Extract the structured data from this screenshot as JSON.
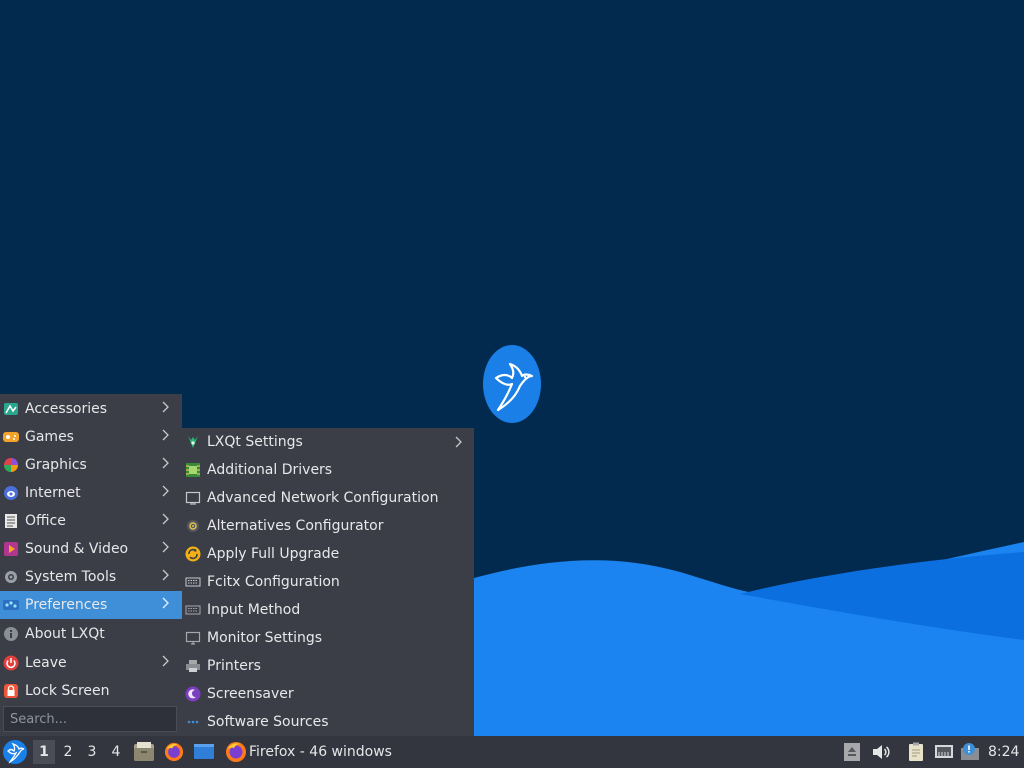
{
  "desktop": {
    "colors": {
      "background": "#022a4e",
      "wave_light": "#1b84f0",
      "wave_dark": "#0a66d9"
    },
    "logo_icon": "lubuntu-hummingbird-logo"
  },
  "main_menu": {
    "items": [
      {
        "label": "Accessories",
        "icon": "accessories-icon",
        "submenu": true
      },
      {
        "label": "Games",
        "icon": "games-icon",
        "submenu": true
      },
      {
        "label": "Graphics",
        "icon": "graphics-icon",
        "submenu": true
      },
      {
        "label": "Internet",
        "icon": "internet-icon",
        "submenu": true
      },
      {
        "label": "Office",
        "icon": "office-icon",
        "submenu": true
      },
      {
        "label": "Sound & Video",
        "icon": "sound-video-icon",
        "submenu": true
      },
      {
        "label": "System Tools",
        "icon": "system-tools-icon",
        "submenu": true
      },
      {
        "label": "Preferences",
        "icon": "preferences-icon",
        "submenu": true,
        "active": true
      },
      {
        "label": "About LXQt",
        "icon": "info-icon",
        "submenu": false
      },
      {
        "label": "Leave",
        "icon": "power-icon",
        "submenu": true
      },
      {
        "label": "Lock Screen",
        "icon": "lock-icon",
        "submenu": false
      }
    ],
    "search_placeholder": "Search..."
  },
  "preferences_menu": {
    "items": [
      {
        "label": "LXQt Settings",
        "icon": "lxqt-settings-icon",
        "submenu": true
      },
      {
        "label": "Additional Drivers",
        "icon": "chip-icon"
      },
      {
        "label": "Advanced Network Configuration",
        "icon": "network-icon"
      },
      {
        "label": "Alternatives Configurator",
        "icon": "alternatives-icon"
      },
      {
        "label": "Apply Full Upgrade",
        "icon": "upgrade-icon"
      },
      {
        "label": "Fcitx Configuration",
        "icon": "keyboard-icon"
      },
      {
        "label": "Input Method",
        "icon": "keyboard-icon"
      },
      {
        "label": "Monitor Settings",
        "icon": "monitor-icon"
      },
      {
        "label": "Printers",
        "icon": "printer-icon"
      },
      {
        "label": "Screensaver",
        "icon": "screensaver-icon"
      },
      {
        "label": "Software Sources",
        "icon": "software-sources-icon"
      }
    ]
  },
  "taskbar": {
    "start_icon": "lubuntu-start-icon",
    "workspaces": [
      "1",
      "2",
      "3",
      "4"
    ],
    "active_workspace": "1",
    "quicklaunch": [
      "file-manager-icon",
      "firefox-icon",
      "show-desktop-icon"
    ],
    "task_label": "Firefox - 46 windows",
    "tray": [
      "eject-icon",
      "volume-icon",
      "clipboard-icon",
      "network-wired-icon",
      "update-notifier-icon"
    ],
    "clock": "8:24"
  }
}
